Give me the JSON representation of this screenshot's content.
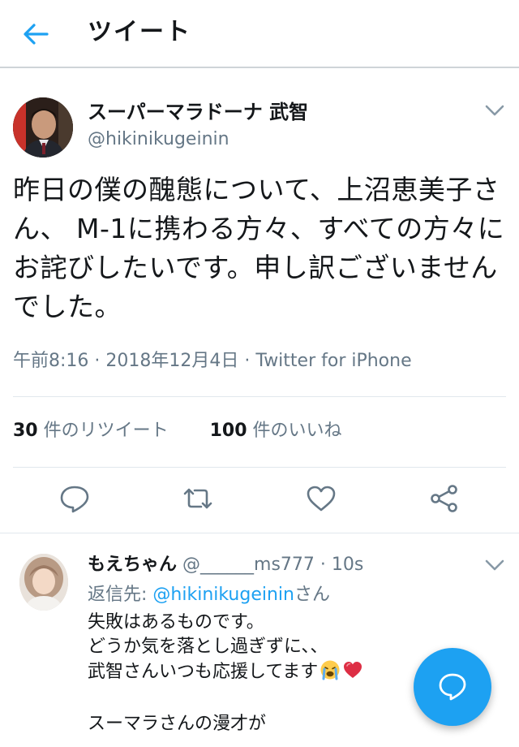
{
  "header": {
    "title": "ツイート"
  },
  "tweet": {
    "author_name": "スーパーマラドーナ 武智",
    "author_handle": "@hikinikugeinin",
    "text": "昨日の僕の醜態について、上沼恵美子さん、 M-1に携わる方々、すべての方々にお詫びしたいです。申し訳ございませんでした。",
    "time": "午前8:16",
    "date": "2018年12月4日",
    "separator": "·",
    "source": "Twitter for iPhone"
  },
  "stats": {
    "retweets_count": "30",
    "retweets_label": " 件のリツイート",
    "likes_count": "100",
    "likes_label": " 件のいいね"
  },
  "actions": [
    "reply-icon",
    "retweet-icon",
    "like-icon",
    "share-icon"
  ],
  "reply": {
    "name": "もえちゃん",
    "handle": "@______ms777",
    "separator": "·",
    "time": "10s",
    "reply_to_prefix": "返信先: ",
    "reply_to_mention": "@hikinikugeinin",
    "reply_to_suffix": "さん",
    "lines": [
      "失敗はあるものです。",
      "どうか気を落とし過ぎずに、、",
      "武智さんいつも応援してます",
      "",
      "スーマラさんの漫才が"
    ],
    "emojis": [
      "crying-face-icon",
      "heart-icon"
    ]
  },
  "colors": {
    "accent": "#1da1f2",
    "secondary_text": "#657786",
    "divider": "#e1e8ed"
  }
}
